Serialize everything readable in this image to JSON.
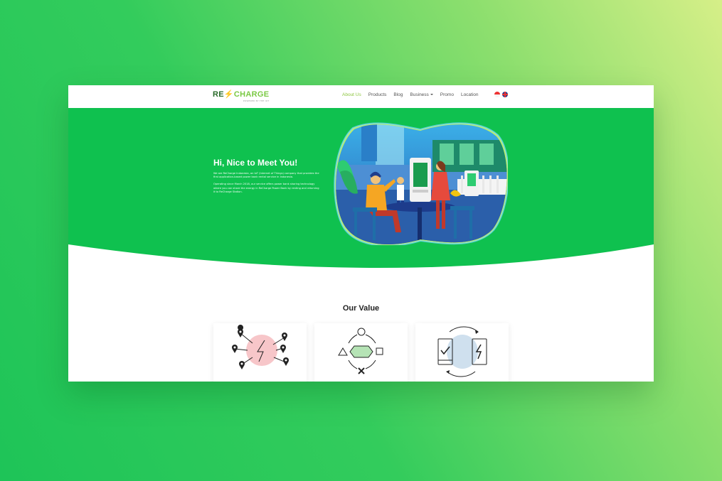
{
  "nav": {
    "logo": {
      "re": "RE",
      "bolt": "⚡",
      "charge": "CHARGE",
      "tagline": "POWERED BY THE IOT"
    },
    "items": [
      {
        "label": "About Us",
        "active": true
      },
      {
        "label": "Products"
      },
      {
        "label": "Blog"
      },
      {
        "label": "Business",
        "dropdown": true
      },
      {
        "label": "Promo"
      },
      {
        "label": "Location"
      }
    ],
    "languages": [
      "flag-indonesia-icon",
      "flag-uk-icon"
    ]
  },
  "hero": {
    "title": "Hi, Nice to Meet You!",
    "paragraph1": "We are ReCharge Indonesia, an IoT (Internet of Things) company that provides the first application-based power bank rental service in Indonesia.",
    "paragraph2": "Operating since March 2018, our service offers power bank sharing technology where you can share the energy in ReCharge Power Bank by renting and returning it to ReCharge Station."
  },
  "values": {
    "title": "Our Value",
    "cards": [
      {
        "icon": "network-energy-icon"
      },
      {
        "icon": "flow-shapes-icon"
      },
      {
        "icon": "phone-charge-icon"
      }
    ]
  },
  "colors": {
    "brand_green": "#0fc14f",
    "accent_lime": "#8dc63f",
    "background": "#2fcc5e"
  }
}
